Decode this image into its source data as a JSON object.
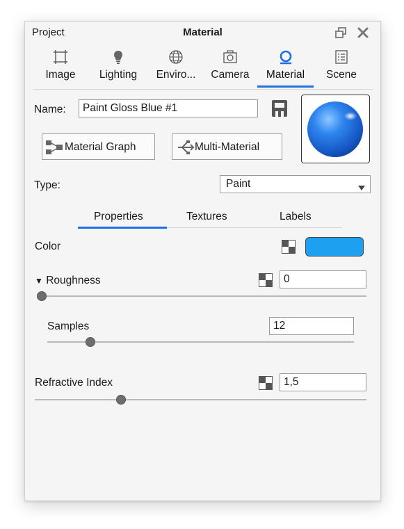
{
  "titlebar": {
    "left_label": "Project",
    "title": "Material",
    "restore_icon": "restore-window-icon",
    "close_icon": "close-icon"
  },
  "tabs": [
    {
      "label": "Image",
      "icon": "image-frame-icon",
      "active": false
    },
    {
      "label": "Lighting",
      "icon": "lightbulb-icon",
      "active": false
    },
    {
      "label": "Enviro...",
      "icon": "globe-icon",
      "active": false
    },
    {
      "label": "Camera",
      "icon": "camera-icon",
      "active": false
    },
    {
      "label": "Material",
      "icon": "material-sphere-icon",
      "active": true
    },
    {
      "label": "Scene",
      "icon": "scene-list-icon",
      "active": false
    }
  ],
  "material": {
    "name_label": "Name:",
    "name_value": "Paint Gloss Blue #1",
    "save_icon": "save-icon",
    "graph_button": "Material Graph",
    "multi_button": "Multi-Material",
    "type_label": "Type:",
    "type_value": "Paint",
    "preview_color": "#1e6fe0"
  },
  "subtabs": [
    {
      "label": "Properties",
      "active": true
    },
    {
      "label": "Textures",
      "active": false
    },
    {
      "label": "Labels",
      "active": false
    }
  ],
  "properties": {
    "color_label": "Color",
    "color_value": "#1ea0f0",
    "roughness_label": "Roughness",
    "roughness_value": "0",
    "roughness_slider": 0.0,
    "samples_label": "Samples",
    "samples_value": "12",
    "samples_slider": 0.14,
    "refractive_label": "Refractive Index",
    "refractive_value": "1,5",
    "refractive_slider": 0.26
  },
  "colors": {
    "accent": "#1e6fe0"
  }
}
